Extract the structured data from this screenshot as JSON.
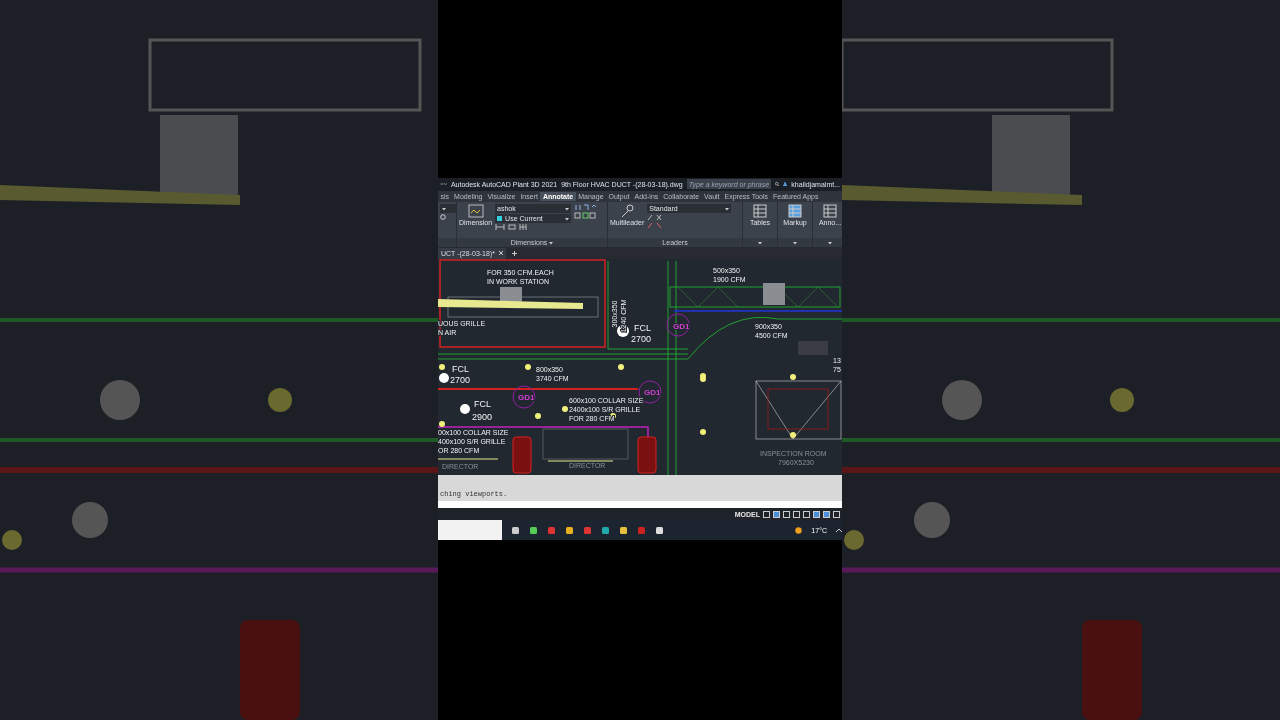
{
  "title_bar": {
    "app_title": "Autodesk AutoCAD Plant 3D 2021",
    "file_name": "9th Floor HVAC DUCT -(28-03-18).dwg",
    "search_placeholder": "Type a keyword or phrase",
    "user": "khalidjamalmt..."
  },
  "ribbon_tabs": [
    {
      "label": "sis",
      "selected": false
    },
    {
      "label": "Modeling",
      "selected": false
    },
    {
      "label": "Visualize",
      "selected": false
    },
    {
      "label": "Insert",
      "selected": false
    },
    {
      "label": "Annotate",
      "selected": true
    },
    {
      "label": "Manage",
      "selected": false
    },
    {
      "label": "Output",
      "selected": false
    },
    {
      "label": "Add-ins",
      "selected": false
    },
    {
      "label": "Collaborate",
      "selected": false
    },
    {
      "label": "Vault",
      "selected": false
    },
    {
      "label": "Express Tools",
      "selected": false
    },
    {
      "label": "Featured Apps",
      "selected": false
    }
  ],
  "ribbon": {
    "dimension_button": "Dimension",
    "dim_style": "ashok",
    "layer": "Use Current",
    "dimensions_panel": "Dimensions",
    "multileader_button": "Multileader",
    "leader_style": "Standard",
    "leaders_panel": "Leaders",
    "tools": [
      "Tables",
      "Markup",
      "Anno..."
    ]
  },
  "document_tab": {
    "label": "UCT -(28-03-18)*"
  },
  "drawing": {
    "labels": [
      {
        "text": "FOR 350 CFM.EACH",
        "kind": "label"
      },
      {
        "text": "IN WORK STATION",
        "kind": "label"
      },
      {
        "text": "500x350",
        "kind": "label"
      },
      {
        "text": "1900 CFM",
        "kind": "label"
      },
      {
        "text": "300x350",
        "kind": "vertical"
      },
      {
        "text": "1240 CFM",
        "kind": "vertical"
      },
      {
        "text": "UOUS GRILLE",
        "kind": "label"
      },
      {
        "text": "N AIR",
        "kind": "label"
      },
      {
        "text": "FCL",
        "kind": "heading"
      },
      {
        "text": "2700",
        "kind": "heading"
      },
      {
        "text": "GD1",
        "kind": "tag"
      },
      {
        "text": "900x350",
        "kind": "label"
      },
      {
        "text": "4500 CFM",
        "kind": "label"
      },
      {
        "text": "FCL",
        "kind": "heading"
      },
      {
        "text": "2700",
        "kind": "heading"
      },
      {
        "text": "800x350",
        "kind": "label"
      },
      {
        "text": "3740 CFM",
        "kind": "label"
      },
      {
        "text": "13",
        "kind": "label"
      },
      {
        "text": "75",
        "kind": "label"
      },
      {
        "text": "GD1",
        "kind": "tag"
      },
      {
        "text": "GD1",
        "kind": "tag"
      },
      {
        "text": "FCL",
        "kind": "heading"
      },
      {
        "text": "2900",
        "kind": "heading"
      },
      {
        "text": "600x100 COLLAR  SIZE",
        "kind": "label"
      },
      {
        "text": "2400x100 S/R GRILLE",
        "kind": "label"
      },
      {
        "text": "FOR 280 CFM",
        "kind": "label"
      },
      {
        "text": "00x100 COLLAR  SIZE",
        "kind": "label"
      },
      {
        "text": "400x100 S/R GRILLE",
        "kind": "label"
      },
      {
        "text": "OR 280 CFM",
        "kind": "label"
      },
      {
        "text": "DIRECTOR",
        "kind": "room"
      },
      {
        "text": "DIRECTOR",
        "kind": "room"
      },
      {
        "text": "INSPECTION ROOM",
        "kind": "room"
      },
      {
        "text": "7960X5230",
        "kind": "room"
      }
    ]
  },
  "command_line": {
    "history": "ching viewports."
  },
  "status_bar": {
    "mode": "MODEL"
  },
  "taskbar": {
    "temperature": "17°C"
  }
}
